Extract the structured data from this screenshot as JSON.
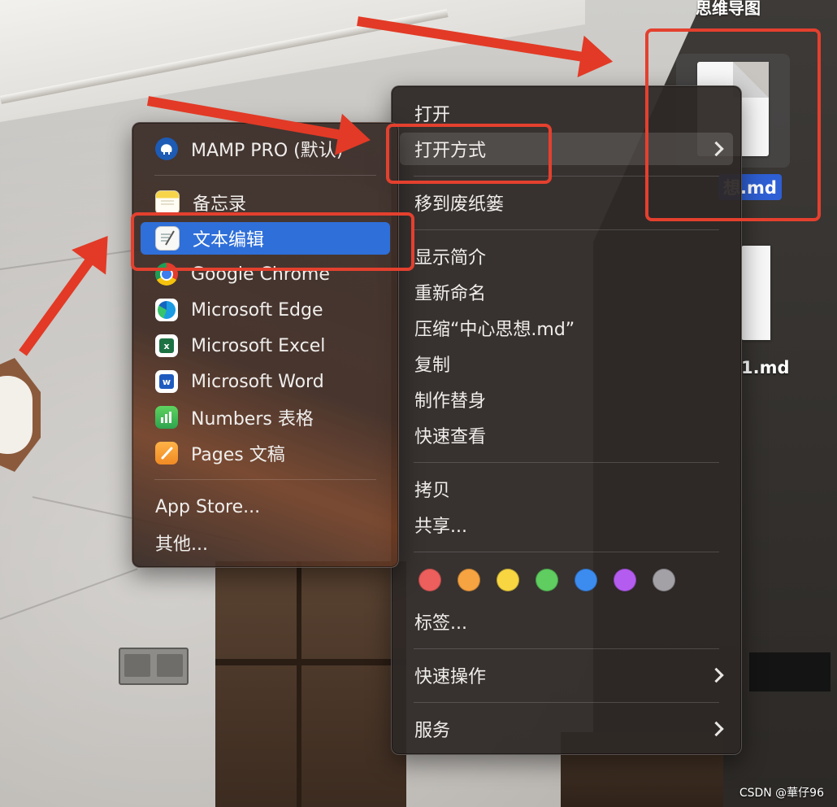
{
  "desktop": {
    "top_label": "思维导图",
    "selected_file_name": "想.md",
    "second_file_name": "1.md"
  },
  "main_menu": {
    "items": [
      {
        "label": "打开"
      },
      {
        "label": "打开方式"
      },
      {
        "label": "移到废纸篓"
      },
      {
        "label": "显示简介"
      },
      {
        "label": "重新命名"
      },
      {
        "label": "压缩“中心思想.md”"
      },
      {
        "label": "复制"
      },
      {
        "label": "制作替身"
      },
      {
        "label": "快速查看"
      },
      {
        "label": "拷贝"
      },
      {
        "label": "共享..."
      },
      {
        "label": "标签..."
      },
      {
        "label": "快速操作"
      },
      {
        "label": "服务"
      }
    ],
    "tag_colors": [
      "#ec5f5d",
      "#f6a341",
      "#f7d642",
      "#5fcd60",
      "#3c8cf0",
      "#b55cf0",
      "#a3a1a6"
    ]
  },
  "open_with_menu": {
    "items": [
      {
        "label": "MAMP PRO (默认)",
        "icon": "mamp-elephant-icon"
      },
      {
        "label": "备忘录",
        "icon": "notes-icon"
      },
      {
        "label": "文本编辑",
        "icon": "textedit-icon"
      },
      {
        "label": "Google Chrome",
        "icon": "chrome-icon"
      },
      {
        "label": "Microsoft Edge",
        "icon": "edge-icon"
      },
      {
        "label": "Microsoft Excel",
        "icon": "excel-icon"
      },
      {
        "label": "Microsoft Word",
        "icon": "word-icon"
      },
      {
        "label": "Numbers 表格",
        "icon": "numbers-icon"
      },
      {
        "label": "Pages 文稿",
        "icon": "pages-icon"
      },
      {
        "label": "App Store..."
      },
      {
        "label": "其他..."
      }
    ]
  },
  "watermark": "CSDN @華仔96",
  "colors": {
    "highlight_blue": "#2f6fd9",
    "annotation_red": "#e4402e"
  }
}
